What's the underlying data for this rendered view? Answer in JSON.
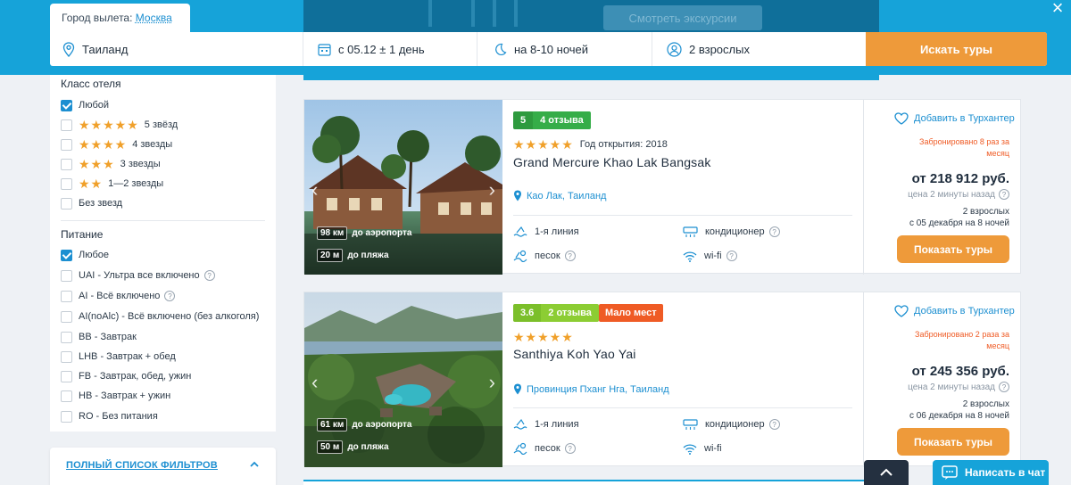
{
  "header": {
    "departure_label": "Город вылета:",
    "departure_city": "Москва",
    "hero_button_label": "Смотреть экскурсии"
  },
  "search": {
    "destination": "Таиланд",
    "date": "с 05.12 ± 1 день",
    "nights": "на 8-10 ночей",
    "adults": "2 взрослых",
    "search_button": "Искать туры"
  },
  "sidebar": {
    "hotel_class": {
      "title": "Класс отеля",
      "options": [
        {
          "label": "Любой",
          "checked": true,
          "stars": 0
        },
        {
          "label": "5 звёзд",
          "checked": false,
          "stars": 5
        },
        {
          "label": "4 звезды",
          "checked": false,
          "stars": 4
        },
        {
          "label": "3 звезды",
          "checked": false,
          "stars": 3
        },
        {
          "label": "1—2 звезды",
          "checked": false,
          "stars": 2
        },
        {
          "label": "Без звезд",
          "checked": false,
          "stars": 0
        }
      ]
    },
    "meals": {
      "title": "Питание",
      "options": [
        {
          "label": "Любое",
          "checked": true,
          "help": false
        },
        {
          "label": "UAI - Ультра все включено",
          "checked": false,
          "help": true
        },
        {
          "label": "AI - Всё включено",
          "checked": false,
          "help": true
        },
        {
          "label": "AI(noAlc) - Всё включено (без алкоголя)",
          "checked": false,
          "help": false
        },
        {
          "label": "BB - Завтрак",
          "checked": false,
          "help": false
        },
        {
          "label": "LHB - Завтрак + обед",
          "checked": false,
          "help": false
        },
        {
          "label": "FB - Завтрак, обед, ужин",
          "checked": false,
          "help": false
        },
        {
          "label": "HB - Завтрак + ужин",
          "checked": false,
          "help": false
        },
        {
          "label": "RO - Без питания",
          "checked": false,
          "help": false
        }
      ]
    },
    "full_filters_link": "ПОЛНЫЙ СПИСОК ФИЛЬТРОВ"
  },
  "hotels": [
    {
      "score": "5",
      "reviews": "4 отзыва",
      "few_places": "",
      "stars": 5,
      "opened": "Год открытия: 2018",
      "name": "Grand Mercure Khao Lak Bangsak",
      "location": "Као Лак, Таиланд",
      "airport_distance": "98 км",
      "airport_label": "до аэропорта",
      "beach_distance": "20 м",
      "beach_label": "до пляжа",
      "features": [
        "1-я линия",
        "кондиционер",
        "песок",
        "wi-fi"
      ],
      "favorite": "Добавить в Турхантер",
      "booked": "Забронировано 8 раз за месяц",
      "price": "от 218 912 руб.",
      "price_note": "цена 2 минуты назад",
      "pax_line1": "2 взрослых",
      "pax_line2": "с 05 декабря на 8 ночей",
      "button": "Показать туры"
    },
    {
      "score": "3.6",
      "reviews": "2 отзыва",
      "few_places": "Мало мест",
      "stars": 5,
      "opened": "",
      "name": "Santhiya Koh Yao Yai",
      "location": "Провинция Пханг Нга, Таиланд",
      "airport_distance": "61 км",
      "airport_label": "до аэропорта",
      "beach_distance": "50 м",
      "beach_label": "до пляжа",
      "features": [
        "1-я линия",
        "кондиционер",
        "песок",
        "wi-fi"
      ],
      "favorite": "Добавить в Турхантер",
      "booked": "Забронировано 2 раза за месяц",
      "price": "от 245 356 руб.",
      "price_note": "цена 2 минуты назад",
      "pax_line1": "2 взрослых",
      "pax_line2": "с 06 декабря на 8 ночей",
      "button": "Показать туры"
    }
  ],
  "chat_button": "Написать в чат",
  "colors": {
    "brand_blue": "#16a3d9",
    "link_blue": "#1c8fd1",
    "cta_orange": "#ee9a3a",
    "alert_red": "#ef5b25",
    "star_gold": "#f0a02a"
  }
}
